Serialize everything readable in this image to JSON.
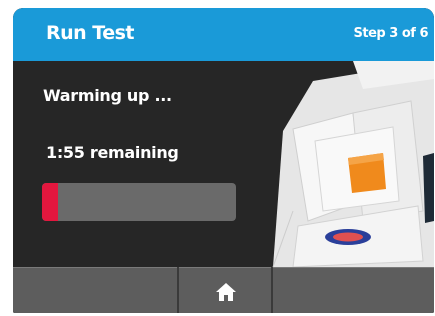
{
  "header": {
    "title": "Run Test",
    "step": "Step 3 of 6"
  },
  "status": {
    "message": "Warming up ...",
    "remaining": "1:55 remaining",
    "progress_fraction": 0.08
  },
  "footer": {
    "home_icon": "home-icon"
  },
  "colors": {
    "header": "#1a9ad8",
    "background": "#262626",
    "progress_track": "#6a6a6a",
    "progress_fill": "#e3173e",
    "footer_button": "#5d5d5d"
  }
}
